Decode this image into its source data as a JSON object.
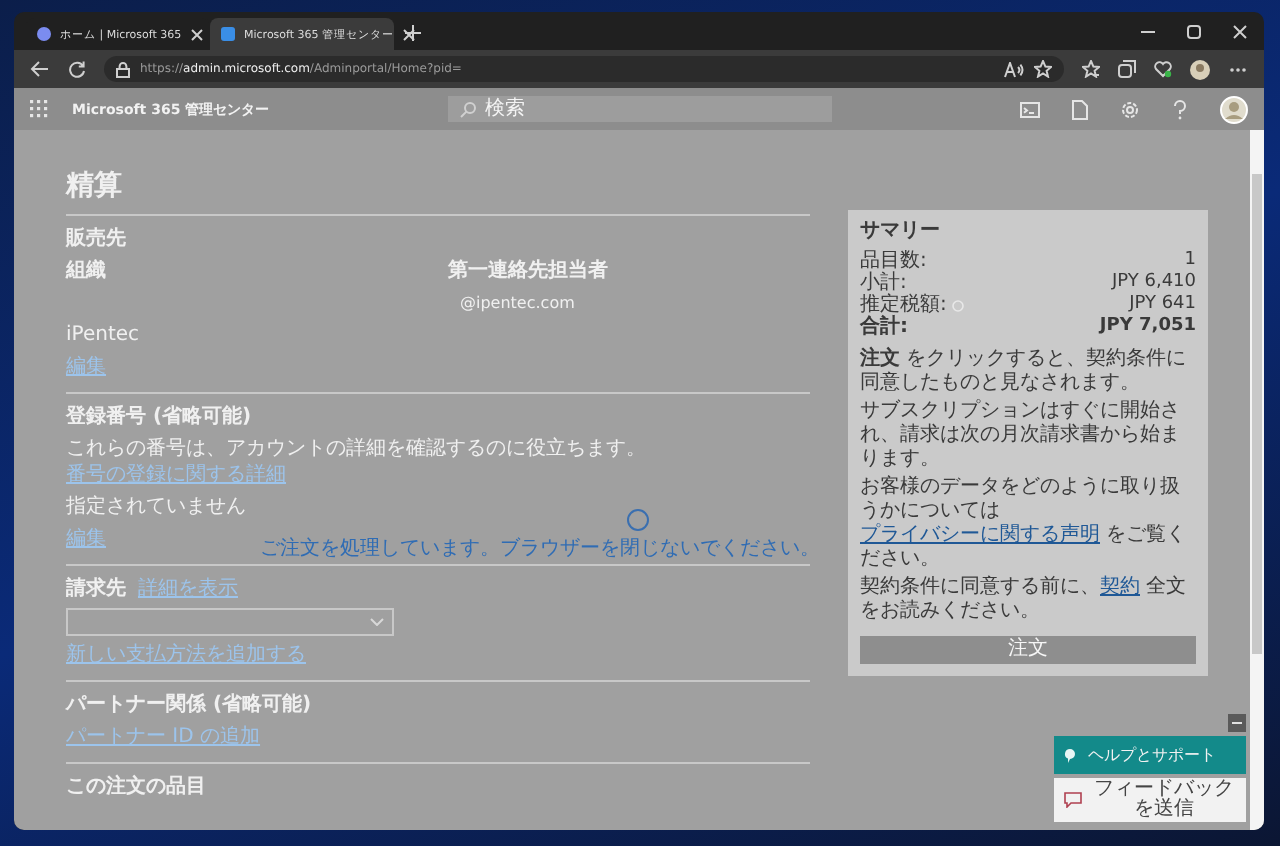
{
  "browser": {
    "tabs": [
      {
        "title": "ホーム | Microsoft 365",
        "selected": false
      },
      {
        "title": "Microsoft 365 管理センター",
        "selected": true
      }
    ],
    "address": {
      "scheme": "https://",
      "host": "admin.microsoft.com",
      "path": "/Adminportal/Home?pid="
    }
  },
  "app_header": {
    "title": "Microsoft 365 管理センター",
    "search": {
      "placeholder": "検索"
    }
  },
  "page": {
    "title": "精算",
    "sections": [
      {
        "rows": [
          {
            "kind": "heading",
            "text": "販売先"
          },
          {
            "kind": "pair",
            "left": "組織",
            "right": "第一連絡先担当者"
          },
          {
            "kind": "offset",
            "text": "@ipentec.com"
          },
          {
            "kind": "text",
            "text": "iPentec"
          },
          {
            "kind": "link",
            "text": "編集"
          }
        ]
      },
      {
        "rows": [
          {
            "kind": "heading",
            "text": "登録番号 (省略可能)"
          },
          {
            "kind": "sentence",
            "segments": [
              {
                "text": "これらの番号は、アカウントの詳細を確認するのに役立ちます。",
                "kind": "text"
              },
              {
                "text": "番号の登録に関する詳細",
                "kind": "link"
              }
            ]
          },
          {
            "kind": "text",
            "text": "指定されていません"
          },
          {
            "kind": "link",
            "text": "編集"
          }
        ]
      },
      {
        "rows": [
          {
            "kind": "heading",
            "text": "請求先",
            "link": "詳細を表示"
          },
          {
            "kind": "dropdown"
          },
          {
            "kind": "link",
            "text": "新しい支払方法を追加する"
          }
        ]
      },
      {
        "rows": [
          {
            "kind": "heading",
            "text": "パートナー関係 (省略可能)"
          },
          {
            "kind": "link",
            "text": "パートナー ID の追加"
          }
        ]
      },
      {
        "rows": [
          {
            "kind": "heading",
            "text": "この注文の品目"
          }
        ]
      }
    ]
  },
  "summary": {
    "title": "サマリー",
    "rows": [
      {
        "kind": "plain",
        "label": "品目数:",
        "value": "1"
      },
      {
        "kind": "plain",
        "label": "小計:",
        "value": "JPY 6,410"
      },
      {
        "kind": "info",
        "label": "推定税額:",
        "value": "JPY 641"
      },
      {
        "kind": "total",
        "label": "合計:",
        "value": "JPY 7,051"
      }
    ],
    "paragraphs": [
      [
        {
          "text": "**注文** をクリックすると、契約条件に同意したものと見なされます。",
          "kind": "text"
        }
      ],
      [
        {
          "text": "サブスクリプションはすぐに開始され、請求は次の月次請求書から始まります。",
          "kind": "text"
        }
      ],
      [
        {
          "text": "お客様のデータをどのように取り扱うかについては ",
          "kind": "text"
        },
        {
          "text": "プライバシーに関する声明",
          "kind": "link"
        },
        {
          "text": " をご覧ください。",
          "kind": "text"
        }
      ],
      [
        {
          "text": "契約条件に同意する前に、",
          "kind": "text"
        },
        {
          "text": "契約",
          "kind": "link"
        },
        {
          "text": " 全文をお読みください。",
          "kind": "text"
        }
      ]
    ],
    "button": {
      "label": "注文",
      "disabled": true
    }
  },
  "processing": {
    "message": "ご注文を処理しています。ブラウザーを閉じないでください。"
  },
  "help": {
    "support": "ヘルプとサポート",
    "feedback": "フィードバックを送信"
  }
}
